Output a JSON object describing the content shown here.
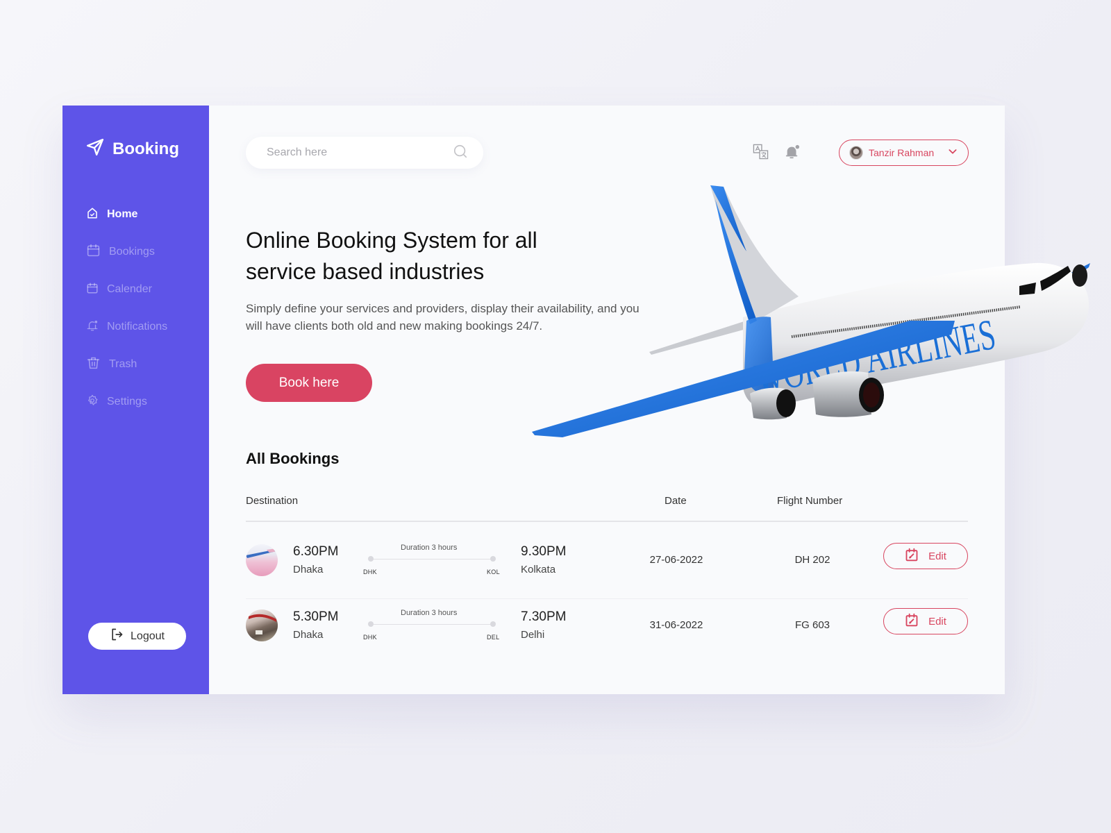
{
  "sidebar": {
    "brand": "Booking",
    "items": [
      {
        "label": "Home",
        "icon": "home-icon",
        "active": true
      },
      {
        "label": "Bookings",
        "icon": "calendar-icon",
        "active": false
      },
      {
        "label": "Calender",
        "icon": "calendar-icon",
        "active": false
      },
      {
        "label": "Notifications",
        "icon": "bell-icon",
        "active": false
      },
      {
        "label": "Trash",
        "icon": "trash-icon",
        "active": false
      },
      {
        "label": "Settings",
        "icon": "gear-icon",
        "active": false
      }
    ],
    "logout_label": "Logout"
  },
  "header": {
    "search_placeholder": "Search here",
    "search_value": "",
    "user_name": "Tanzir Rahman"
  },
  "hero": {
    "title": "Online Booking System for all service based industries",
    "subtitle": "Simply define your services and providers, display their availability, and you will have clients both old and new making bookings 24/7.",
    "cta_label": "Book here",
    "image_text": "WORLD AIRLINES"
  },
  "bookings": {
    "title": "All Bookings",
    "columns": {
      "destination": "Destination",
      "date": "Date",
      "flight_number": "Flight Number"
    },
    "rows": [
      {
        "depart_time": "6.30PM",
        "depart_city": "Dhaka",
        "duration": "Duration 3 hours",
        "from_code": "DHK",
        "to_code": "KOL",
        "arrive_time": "9.30PM",
        "arrive_city": "Kolkata",
        "date": "27-06-2022",
        "flight": "DH 202",
        "action": "Edit"
      },
      {
        "depart_time": "5.30PM",
        "depart_city": "Dhaka",
        "duration": "Duration 3 hours",
        "from_code": "DHK",
        "to_code": "DEL",
        "arrive_time": "7.30PM",
        "arrive_city": "Delhi",
        "date": "31-06-2022",
        "flight": "FG 603",
        "action": "Edit"
      }
    ]
  },
  "colors": {
    "sidebar": "#5e54e8",
    "accent": "#d94462",
    "background": "#f9fafc",
    "plane_blue": "#1a6fd6"
  }
}
